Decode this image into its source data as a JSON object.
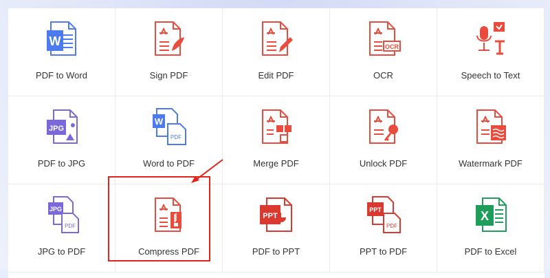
{
  "tools": [
    {
      "label": "PDF to Word",
      "icon": "word-document-icon"
    },
    {
      "label": "Sign PDF",
      "icon": "sign-pdf-icon"
    },
    {
      "label": "Edit PDF",
      "icon": "edit-pdf-icon"
    },
    {
      "label": "OCR",
      "icon": "ocr-icon"
    },
    {
      "label": "Speech to Text",
      "icon": "speech-to-text-icon"
    },
    {
      "label": "PDF to JPG",
      "icon": "jpg-image-icon"
    },
    {
      "label": "Word to PDF",
      "icon": "word-to-pdf-icon"
    },
    {
      "label": "Merge PDF",
      "icon": "merge-pdf-icon"
    },
    {
      "label": "Unlock PDF",
      "icon": "unlock-pdf-icon"
    },
    {
      "label": "Watermark PDF",
      "icon": "watermark-pdf-icon"
    },
    {
      "label": "JPG to PDF",
      "icon": "jpg-to-pdf-icon"
    },
    {
      "label": "Compress PDF",
      "icon": "compress-pdf-icon"
    },
    {
      "label": "PDF to PPT",
      "icon": "powerpoint-icon"
    },
    {
      "label": "PPT to PDF",
      "icon": "ppt-to-pdf-icon"
    },
    {
      "label": "PDF to Excel",
      "icon": "excel-icon"
    }
  ],
  "icon_text": {
    "word": "W",
    "jpg": "JPG",
    "pdf": "PDF",
    "ocr": "OCR",
    "ppt": "PPT",
    "excel": "X"
  },
  "colors": {
    "pdf_red": "#e94b3c",
    "word_blue": "#4b7bec",
    "jpg_purple": "#7b68d9",
    "ppt_red": "#d9392e",
    "excel_green": "#1e9e5a",
    "highlight": "#e2231a"
  },
  "highlighted_tool": "Compress PDF"
}
